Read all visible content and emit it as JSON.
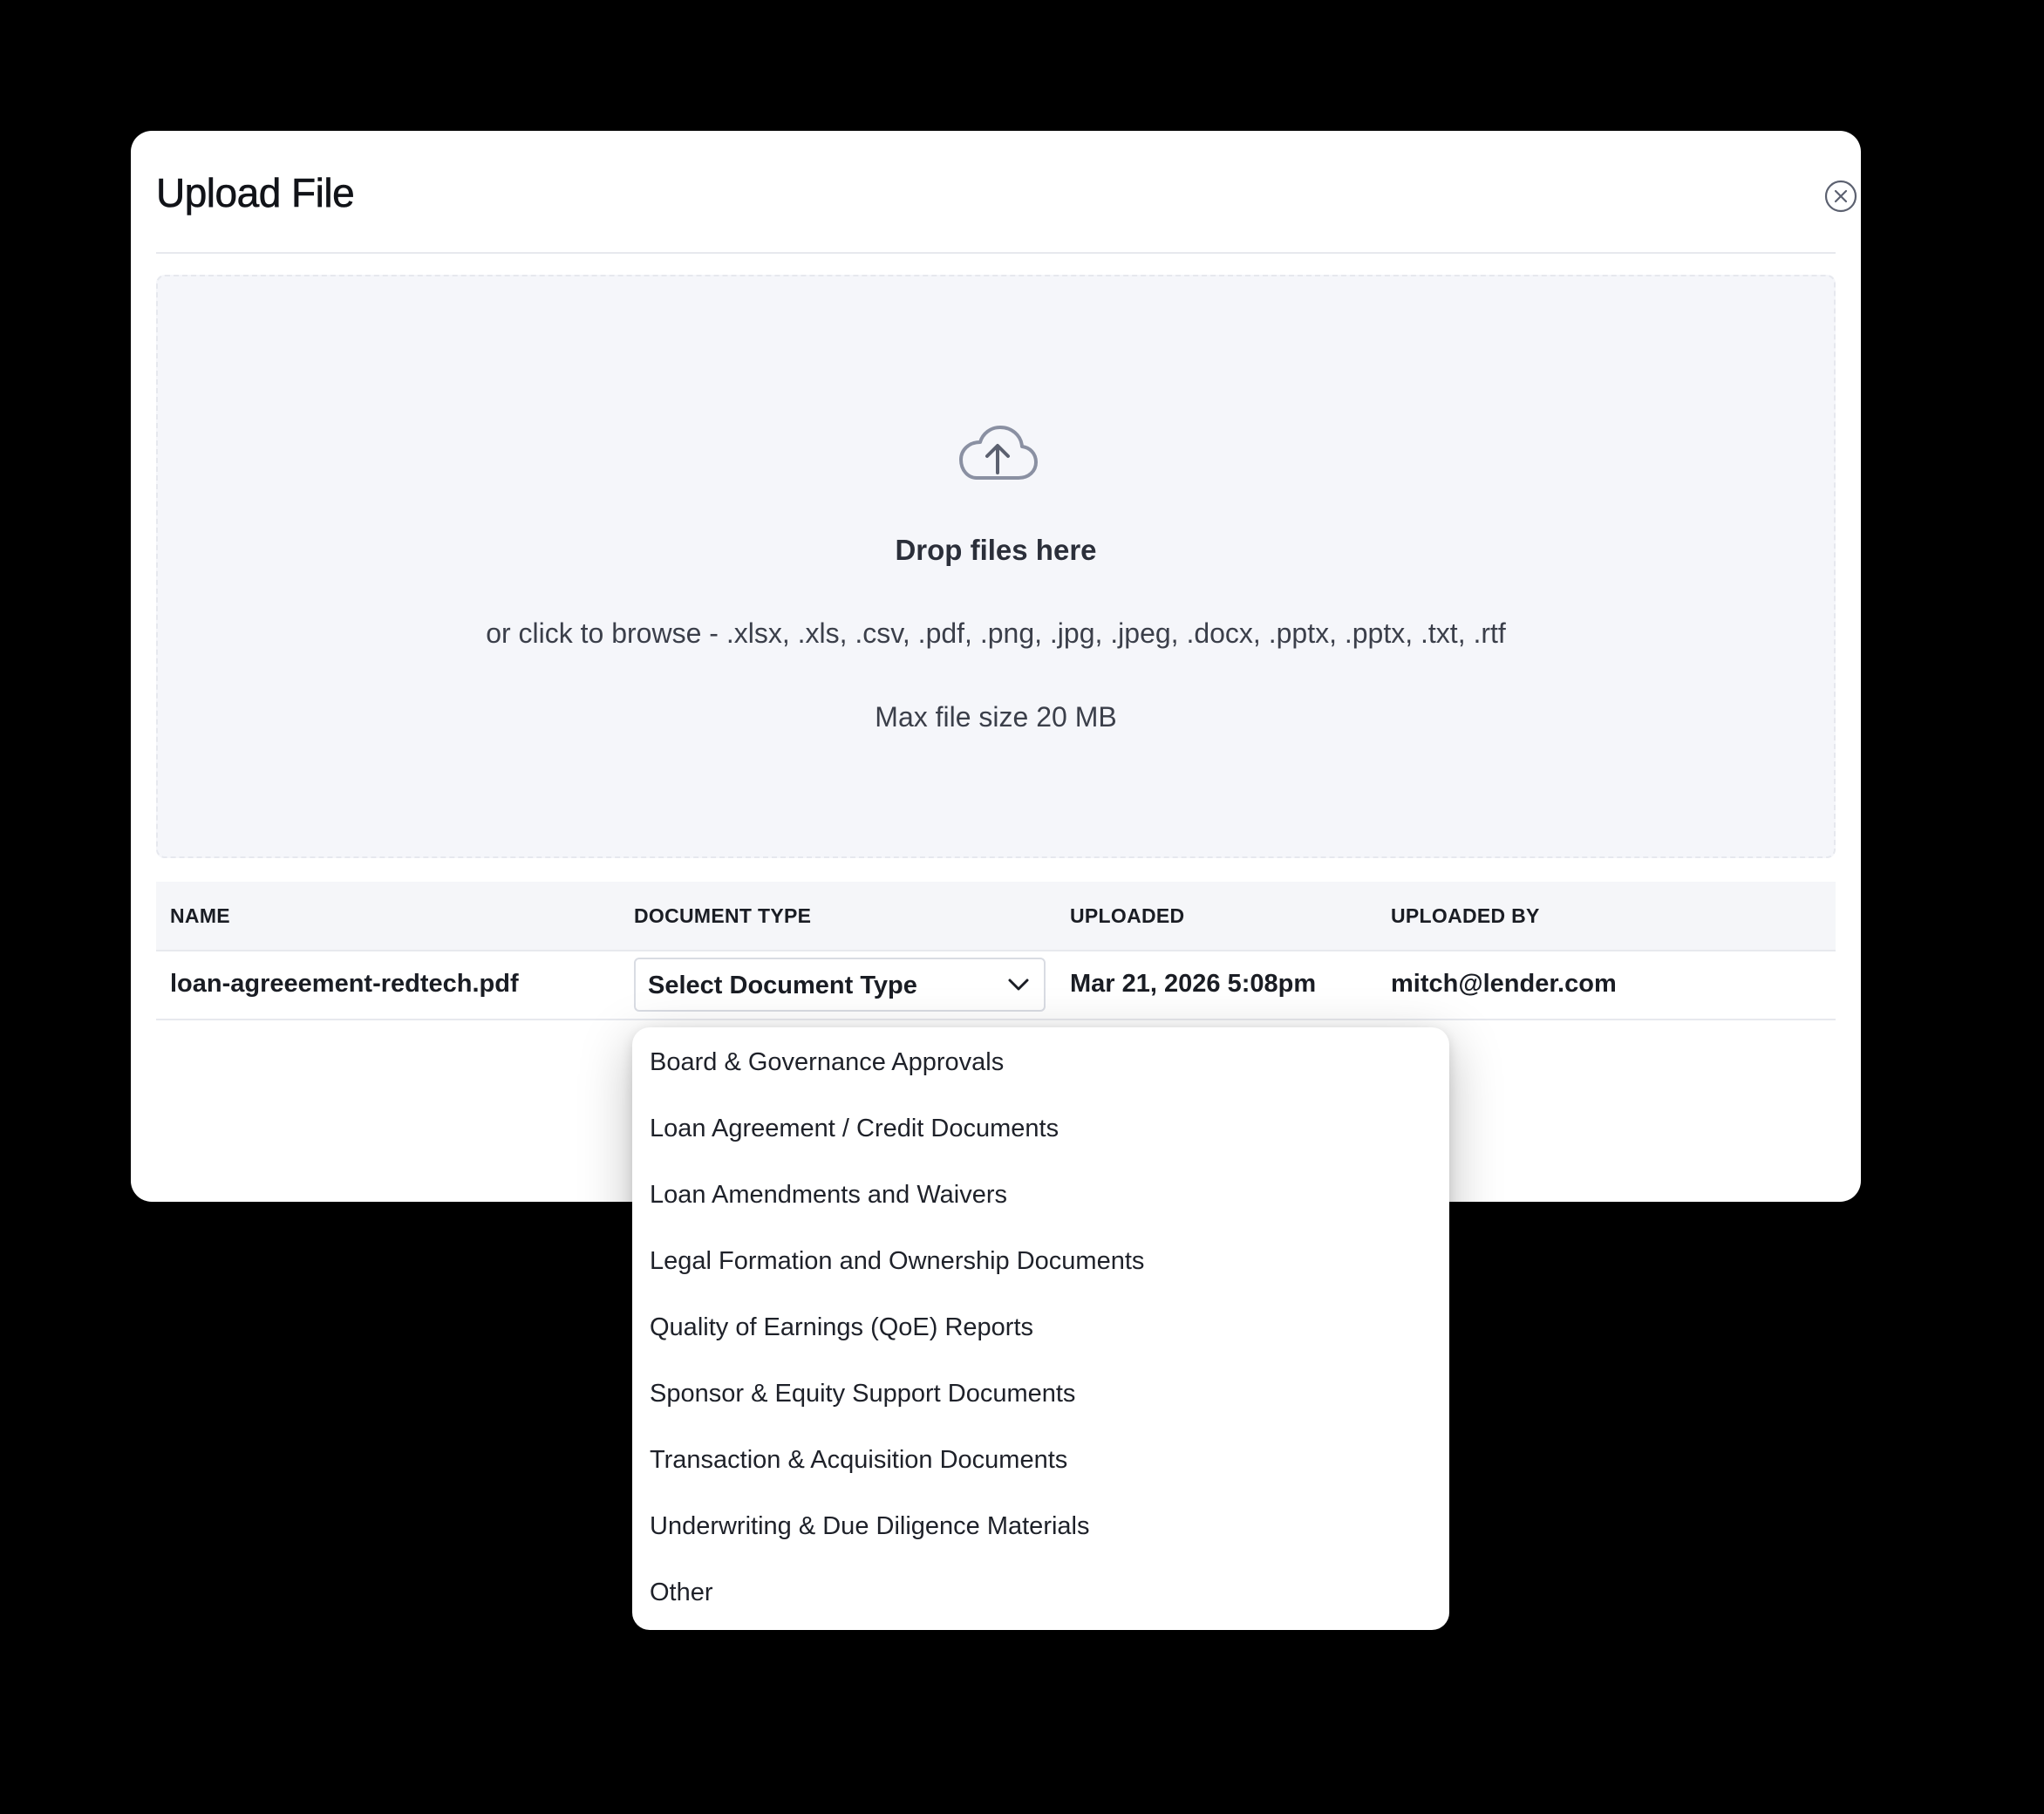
{
  "modal": {
    "title": "Upload File",
    "close_icon": "close-circle-icon"
  },
  "dropzone": {
    "icon": "cloud-upload-icon",
    "title": "Drop files here",
    "subtitle": "or click to browse - .xlsx, .xls, .csv, .pdf, .png, .jpg, .jpeg, .docx, .pptx, .pptx, .txt, .rtf",
    "max_size": "Max file size 20 MB"
  },
  "table": {
    "headers": [
      "NAME",
      "DOCUMENT TYPE",
      "UPLOADED",
      "UPLOADED BY"
    ],
    "rows": [
      {
        "name": "loan-agreeement-redtech.pdf",
        "document_type": "Select Document Type",
        "uploaded": "Mar 21, 2026 5:08pm",
        "uploaded_by": "mitch@lender.com"
      }
    ]
  },
  "dropdown": {
    "options": [
      "Board & Governance Approvals",
      "Loan Agreement / Credit Documents",
      "Loan Amendments and Waivers",
      "Legal Formation and Ownership Documents",
      "Quality of Earnings (QoE) Reports",
      "Sponsor & Equity Support Documents",
      "Transaction & Acquisition Documents",
      "Underwriting & Due Diligence Materials",
      "Other"
    ]
  },
  "colors": {
    "backdrop": "#000000",
    "surface": "#ffffff",
    "dropzone_bg": "#f5f6fa",
    "icon": "#8a90a2",
    "text": "#1a1d24"
  }
}
